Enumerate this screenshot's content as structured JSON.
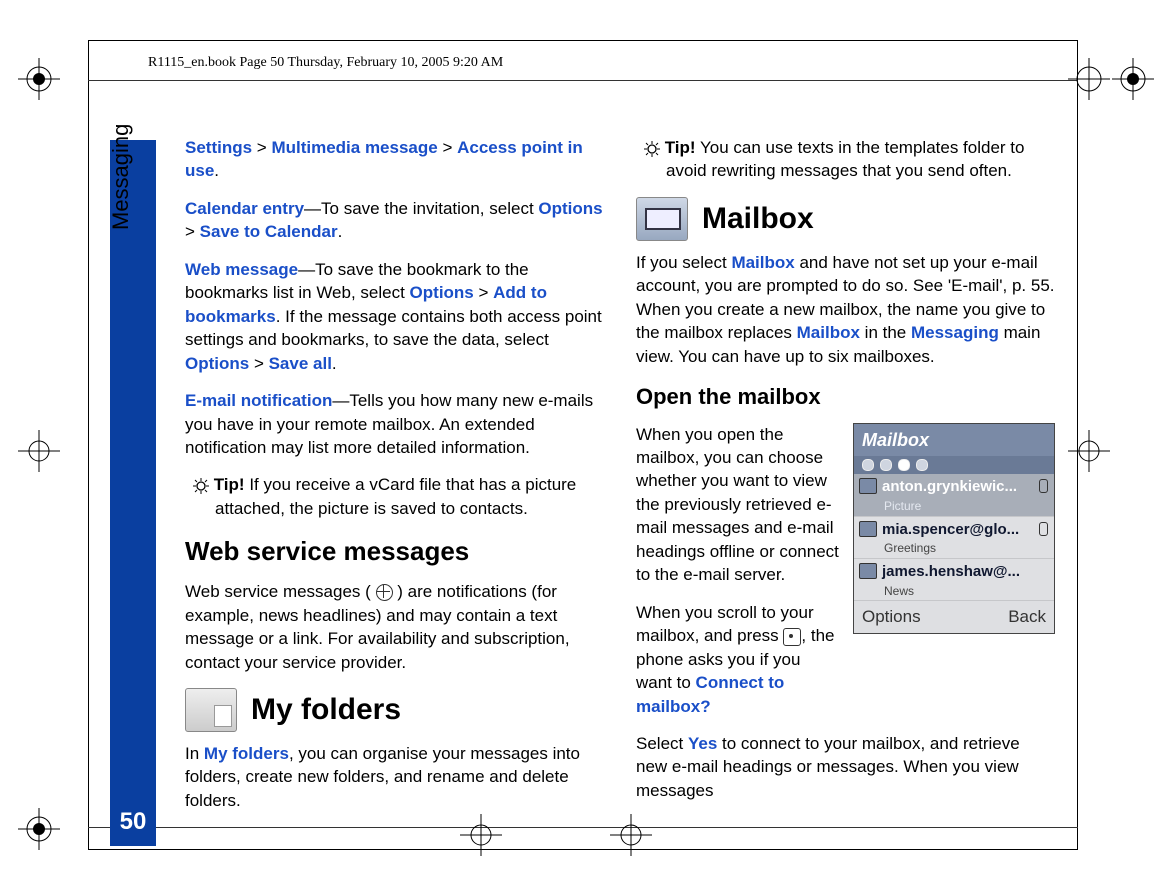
{
  "header": "R1115_en.book  Page 50  Thursday, February 10, 2005  9:20 AM",
  "side_label": "Messaging",
  "page_number": "50",
  "left": {
    "p1": {
      "a": "Settings",
      "b": "Multimedia message",
      "c": "Access point in use"
    },
    "p2": {
      "lead": "Calendar entry",
      "txt": "—To save the invitation, select ",
      "opt": "Options",
      "save": "Save to Calendar"
    },
    "p3": {
      "lead": "Web message",
      "t1": "—To save the bookmark to the bookmarks list in Web, select ",
      "opt": "Options",
      "add": "Add to bookmarks",
      "t2": ". If the message contains both access point settings and bookmarks, to save the data, select ",
      "opt2": "Options",
      "saveall": "Save all"
    },
    "p4": {
      "lead": "E-mail notification",
      "txt": "—Tells you how many new e-mails you have in your remote mailbox. An extended notification may list more detailed information."
    },
    "tip1": {
      "lead": "Tip!",
      "txt": " If you receive a vCard file that has a picture attached, the picture is saved to contacts."
    },
    "h_web": "Web service messages",
    "p5_a": "Web service messages ( ",
    "p5_b": " ) are notifications (for example, news headlines) and may contain a text message or a link. For availability and subscription, contact your service provider.",
    "h_myfolders": "My folders",
    "p6": {
      "a": "In ",
      "b": "My folders",
      "c": ", you can organise your messages into folders, create new folders, and rename and delete folders."
    }
  },
  "right": {
    "tip2": {
      "lead": "Tip!",
      "txt": " You can use texts in the templates folder to avoid rewriting messages that you send often."
    },
    "h_mailbox": "Mailbox",
    "p1": {
      "a": "If you select ",
      "b": "Mailbox",
      "c": " and have not set up your e-mail account, you are prompted to do so. See 'E-mail', p. 55. When you create a new mailbox, the name you give to the mailbox replaces ",
      "d": "Mailbox",
      "e": " in the ",
      "f": "Messaging",
      "g": " main view. You can have up to six mailboxes."
    },
    "h_open": "Open the mailbox",
    "p2": "When you open the mailbox, you can choose whether you want to view the previously retrieved e-mail messages and e-mail headings offline or connect to the e-mail server.",
    "p3": {
      "a": "When you scroll to your mailbox, and press  ",
      "b": ", the phone asks you if you want to ",
      "c": "Connect to mailbox?"
    },
    "p4": {
      "a": "Select ",
      "b": "Yes",
      "c": " to connect to your mailbox, and retrieve new e-mail headings or messages. When you view messages"
    }
  },
  "phone": {
    "title": "Mailbox",
    "rows": [
      {
        "sender": "anton.grynkiewic...",
        "sub": "Picture",
        "sel": true,
        "clip": true
      },
      {
        "sender": "mia.spencer@glo...",
        "sub": "Greetings",
        "sel": false,
        "clip": true
      },
      {
        "sender": "james.henshaw@...",
        "sub": "News",
        "sel": false,
        "clip": false
      }
    ],
    "sk_left": "Options",
    "sk_right": "Back"
  }
}
